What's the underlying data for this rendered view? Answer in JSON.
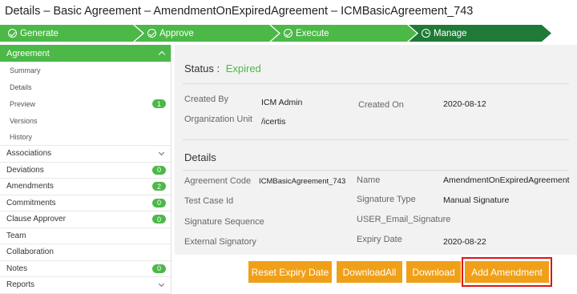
{
  "page": {
    "title": "Details – Basic Agreement – AmendmentOnExpiredAgreement – ICMBasicAgreement_743"
  },
  "workflow": {
    "steps": [
      {
        "label": "Generate",
        "icon": "check-circle-icon",
        "state": "done"
      },
      {
        "label": "Approve",
        "icon": "check-circle-icon",
        "state": "done"
      },
      {
        "label": "Execute",
        "icon": "check-circle-icon",
        "state": "done"
      },
      {
        "label": "Manage",
        "icon": "clock-icon",
        "state": "current"
      }
    ],
    "colors": {
      "done": "#4cb848",
      "current": "#1f7a37"
    }
  },
  "sidebar": {
    "header": "Agreement",
    "sub_items": [
      {
        "label": "Summary",
        "badge": ""
      },
      {
        "label": "Details",
        "badge": ""
      },
      {
        "label": "Preview",
        "badge": "1"
      },
      {
        "label": "Versions",
        "badge": ""
      },
      {
        "label": "History",
        "badge": ""
      }
    ],
    "items": [
      {
        "label": "Associations",
        "badge": "",
        "expandable": true
      },
      {
        "label": "Deviations",
        "badge": "0"
      },
      {
        "label": "Amendments",
        "badge": "2"
      },
      {
        "label": "Commitments",
        "badge": "0"
      },
      {
        "label": "Clause Approver",
        "badge": "0"
      },
      {
        "label": "Team",
        "badge": ""
      },
      {
        "label": "Collaboration",
        "badge": ""
      },
      {
        "label": "Notes",
        "badge": "0"
      },
      {
        "label": "Reports",
        "badge": "",
        "expandable": true
      }
    ]
  },
  "main": {
    "status_label": "Status :",
    "status_value": "Expired",
    "created_by_label": "Created By",
    "created_by_value": "ICM Admin",
    "created_on_label": "Created On",
    "created_on_value": "2020-08-12",
    "org_unit_label": "Organization Unit",
    "org_unit_value": "/icertis",
    "details_heading": "Details",
    "fields": {
      "agreement_code_label": "Agreement Code",
      "agreement_code_value": "ICMBasicAgreement_743",
      "name_label": "Name",
      "name_value": "AmendmentOnExpiredAgreement",
      "test_case_label": "Test Case Id",
      "signature_type_label": "Signature Type",
      "signature_type_value": "Manual Signature",
      "signature_seq_label": "Signature Sequence",
      "user_email_label": "USER_Email_Signature",
      "external_signatory_label": "External Signatory",
      "expiry_date_label": "Expiry Date",
      "expiry_date_value": "2020-08-22"
    }
  },
  "actions": {
    "reset_expiry": "Reset Expiry Date",
    "download_all": "DownloadAll",
    "download": "Download",
    "add_amendment": "Add Amendment"
  },
  "colors": {
    "accent_green": "#4cb848",
    "button_orange": "#f0a018",
    "highlight_red": "#e01414"
  }
}
